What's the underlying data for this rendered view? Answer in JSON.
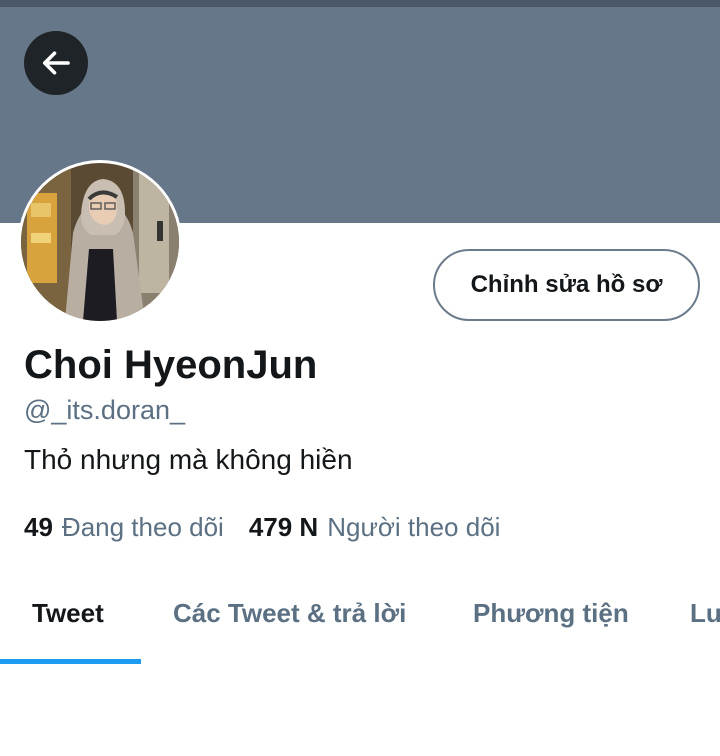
{
  "profile": {
    "display_name": "Choi HyeonJun",
    "handle": "@_its.doran_",
    "bio": "Thỏ nhưng mà không hiền",
    "edit_button_label": "Chỉnh sửa hồ sơ"
  },
  "stats": {
    "following_count": "49",
    "following_label": "Đang theo dõi",
    "followers_count": "479 N",
    "followers_label": "Người theo dõi"
  },
  "tabs": [
    {
      "label": "Tweet",
      "active": true
    },
    {
      "label": "Các Tweet & trả lời",
      "active": false
    },
    {
      "label": "Phương tiện",
      "active": false
    },
    {
      "label": "Lư",
      "active": false
    }
  ],
  "colors": {
    "banner": "#66778a",
    "accent": "#1d9bf0",
    "secondary_text": "#5b7083"
  },
  "icons": {
    "back": "arrow-left-icon"
  }
}
